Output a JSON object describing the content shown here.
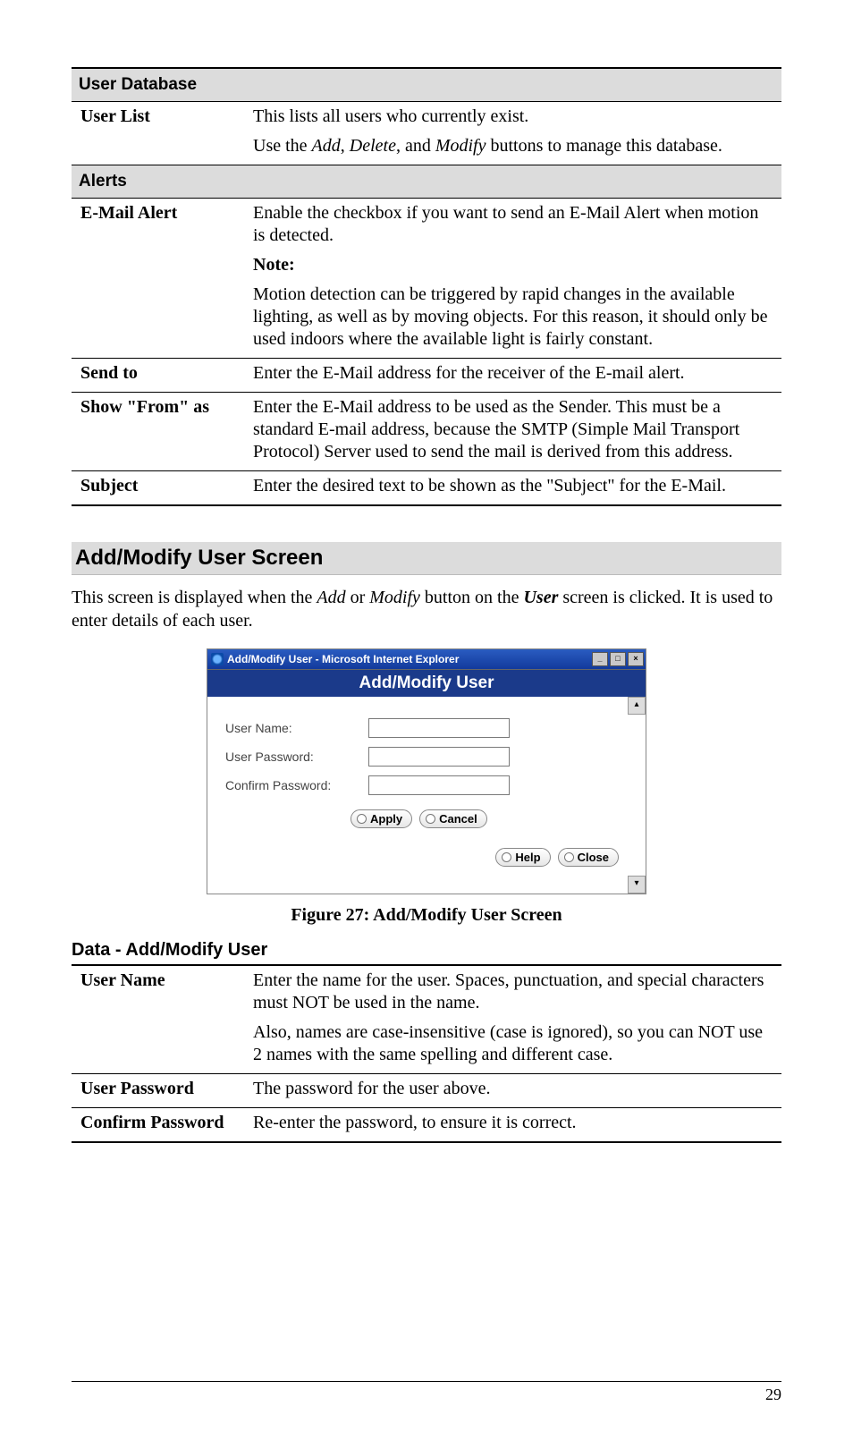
{
  "sections": {
    "user_database": {
      "header": "User Database",
      "user_list": {
        "label": "User List",
        "p1": "This lists all users who currently exist.",
        "p2_pre": "Use the ",
        "p2_add": "Add",
        "p2_sep1": ", ",
        "p2_del": "Delete",
        "p2_sep2": ", and ",
        "p2_mod": "Modify",
        "p2_post": " buttons to manage this database."
      }
    },
    "alerts": {
      "header": "Alerts",
      "email_alert": {
        "label": "E-Mail Alert",
        "p1": "Enable the checkbox if you want to send an E-Mail Alert when motion is detected.",
        "note_label": "Note:",
        "p2": "Motion detection can be triggered by rapid changes in the available lighting, as well as by moving objects. For this reason, it should only be used indoors where the available light is fairly constant."
      },
      "send_to": {
        "label": "Send to",
        "text": "Enter the E-Mail address for the receiver of the E-mail alert."
      },
      "show_from": {
        "label": "Show \"From\" as",
        "text": "Enter the E-Mail address to be used as the Sender. This must be a standard E-mail address, because the SMTP (Simple Mail Transport Protocol) Server used to send the mail is derived from this address."
      },
      "subject": {
        "label": "Subject",
        "text": "Enter the desired text to be shown as the \"Subject\" for the E-Mail."
      }
    }
  },
  "add_modify": {
    "heading": "Add/Modify User Screen",
    "intro_pre": "This screen is displayed when the ",
    "intro_add": "Add",
    "intro_mid1": " or ",
    "intro_mod": "Modify",
    "intro_mid2": " button on the ",
    "intro_user": "User",
    "intro_post": " screen is clicked. It is used to enter details of each user."
  },
  "dialog": {
    "window_title": "Add/Modify User - Microsoft Internet Explorer",
    "min": "_",
    "max": "□",
    "close": "×",
    "header": "Add/Modify User",
    "scroll_up": "▴",
    "scroll_dn": "▾",
    "username_label": "User Name:",
    "password_label": "User Password:",
    "confirm_label": "Confirm Password:",
    "btn_apply": "Apply",
    "btn_cancel": "Cancel",
    "btn_help": "Help",
    "btn_close": "Close"
  },
  "figure_caption": "Figure 27: Add/Modify User Screen",
  "data_section": {
    "heading": "Data - Add/Modify User",
    "user_name": {
      "label": "User Name",
      "p1": "Enter the name for the user. Spaces, punctuation, and special characters must NOT be used in the name.",
      "p2": "Also, names are case-insensitive (case is ignored), so you can NOT use 2 names with the same spelling and different case."
    },
    "user_password": {
      "label": "User Password",
      "text": "The password for the user above."
    },
    "confirm_password": {
      "label": "Confirm Password",
      "text": "Re-enter the password, to ensure it is correct."
    }
  },
  "page_number": "29"
}
